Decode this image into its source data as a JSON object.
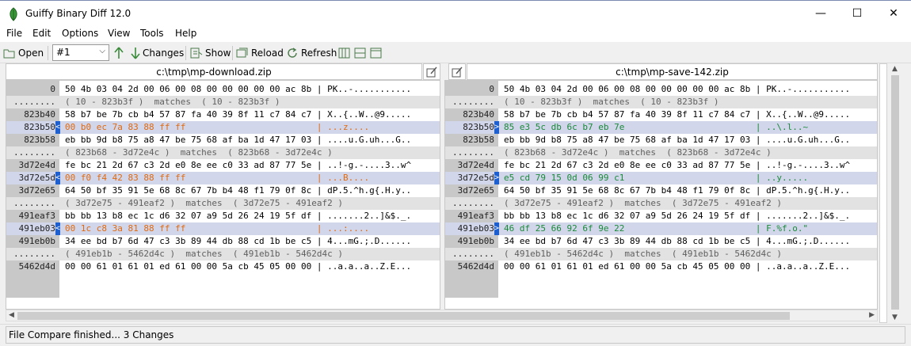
{
  "window": {
    "title": "Guiffy Binary Diff 12.0",
    "minimize": "—",
    "maximize": "☐",
    "close": "✕"
  },
  "menu": [
    "File",
    "Edit",
    "Options",
    "View",
    "Tools",
    "Help"
  ],
  "toolbar": {
    "open": "Open",
    "change_selector": "#1",
    "changes": "Changes",
    "show": "Show",
    "reload": "Reload",
    "refresh": "Refresh"
  },
  "left": {
    "file": "c:\\tmp\\mp-download.zip",
    "rows": [
      {
        "addr": "0",
        "marker": "",
        "kind": "normal",
        "hex": "50 4b 03 04 2d 00 06 00 08 00 00 00 00 00 ac 8b | PK..-..........."
      },
      {
        "addr": "........",
        "marker": "",
        "kind": "match",
        "hex": "( 10 - 823b3f )  matches  ( 10 - 823b3f )"
      },
      {
        "addr": "823b40",
        "marker": "",
        "kind": "normal",
        "hex": "58 b7 be 7b cb b4 57 87 fa 40 39 8f 11 c7 84 c7 | X..{..W..@9....."
      },
      {
        "addr": "823b50",
        "marker": "<",
        "kind": "chg-orange",
        "hex": "00 b0 ec 7a 83 88 ff ff                         | ...z...."
      },
      {
        "addr": "823b58",
        "marker": "",
        "kind": "normal",
        "hex": "eb bb 9d b8 75 a8 47 be 75 68 af ba 1d 47 17 03 | ....u.G.uh...G.."
      },
      {
        "addr": "........",
        "marker": "",
        "kind": "match",
        "hex": "( 823b68 - 3d72e4c )  matches  ( 823b68 - 3d72e4c )"
      },
      {
        "addr": "3d72e4d",
        "marker": "",
        "kind": "normal",
        "hex": "fe bc 21 2d 67 c3 2d e0 8e ee c0 33 ad 87 77 5e | ..!-g.-....3..w^"
      },
      {
        "addr": "3d72e5d",
        "marker": "<",
        "kind": "chg-orange",
        "hex": "00 f0 f4 42 83 88 ff ff                         | ...B...."
      },
      {
        "addr": "3d72e65",
        "marker": "",
        "kind": "normal",
        "hex": "64 50 bf 35 91 5e 68 8c 67 7b b4 48 f1 79 0f 8c | dP.5.^h.g{.H.y.."
      },
      {
        "addr": "........",
        "marker": "",
        "kind": "match",
        "hex": "( 3d72e75 - 491eaf2 )  matches  ( 3d72e75 - 491eaf2 )"
      },
      {
        "addr": "491eaf3",
        "marker": "",
        "kind": "normal",
        "hex": "bb bb 13 b8 ec 1c d6 32 07 a9 5d 26 24 19 5f df | .......2..]&$._."
      },
      {
        "addr": "491eb03",
        "marker": "<",
        "kind": "chg-orange",
        "hex": "00 1c c8 3a 81 88 ff ff                         | ...:...."
      },
      {
        "addr": "491eb0b",
        "marker": "",
        "kind": "normal",
        "hex": "34 ee bd b7 6d 47 c3 3b 89 44 db 88 cd 1b be c5 | 4...mG.;.D......"
      },
      {
        "addr": "........",
        "marker": "",
        "kind": "match",
        "hex": "( 491eb1b - 5462d4c )  matches  ( 491eb1b - 5462d4c )"
      },
      {
        "addr": "5462d4d",
        "marker": "",
        "kind": "normal",
        "hex": "00 00 61 01 61 01 ed 61 00 00 5a cb 45 05 00 00 | ..a.a..a..Z.E..."
      }
    ]
  },
  "right": {
    "file": "c:\\tmp\\mp-save-142.zip",
    "rows": [
      {
        "addr": "0",
        "marker": "",
        "kind": "normal",
        "hex": "50 4b 03 04 2d 00 06 00 08 00 00 00 00 00 ac 8b | PK..-..........."
      },
      {
        "addr": "........",
        "marker": "",
        "kind": "match",
        "hex": "( 10 - 823b3f )  matches  ( 10 - 823b3f )"
      },
      {
        "addr": "823b40",
        "marker": "",
        "kind": "normal",
        "hex": "58 b7 be 7b cb b4 57 87 fa 40 39 8f 11 c7 84 c7 | X..{..W..@9....."
      },
      {
        "addr": "823b50",
        "marker": ">",
        "kind": "chg-green",
        "hex": "85 e3 5c db 6c b7 eb 7e                         | ..\\.l..~"
      },
      {
        "addr": "823b58",
        "marker": "",
        "kind": "normal",
        "hex": "eb bb 9d b8 75 a8 47 be 75 68 af ba 1d 47 17 03 | ....u.G.uh...G.."
      },
      {
        "addr": "........",
        "marker": "",
        "kind": "match",
        "hex": "( 823b68 - 3d72e4c )  matches  ( 823b68 - 3d72e4c )"
      },
      {
        "addr": "3d72e4d",
        "marker": "",
        "kind": "normal",
        "hex": "fe bc 21 2d 67 c3 2d e0 8e ee c0 33 ad 87 77 5e | ..!-g.-....3..w^"
      },
      {
        "addr": "3d72e5d",
        "marker": ">",
        "kind": "chg-green",
        "hex": "e5 cd 79 15 0d 06 99 c1                         | ..y....."
      },
      {
        "addr": "3d72e65",
        "marker": "",
        "kind": "normal",
        "hex": "64 50 bf 35 91 5e 68 8c 67 7b b4 48 f1 79 0f 8c | dP.5.^h.g{.H.y.."
      },
      {
        "addr": "........",
        "marker": "",
        "kind": "match",
        "hex": "( 3d72e75 - 491eaf2 )  matches  ( 3d72e75 - 491eaf2 )"
      },
      {
        "addr": "491eaf3",
        "marker": "",
        "kind": "normal",
        "hex": "bb bb 13 b8 ec 1c d6 32 07 a9 5d 26 24 19 5f df | .......2..]&$._."
      },
      {
        "addr": "491eb03",
        "marker": ">",
        "kind": "chg-green",
        "hex": "46 df 25 66 92 6f 9e 22                         | F.%f.o.\""
      },
      {
        "addr": "491eb0b",
        "marker": "",
        "kind": "normal",
        "hex": "34 ee bd b7 6d 47 c3 3b 89 44 db 88 cd 1b be c5 | 4...mG.;.D......"
      },
      {
        "addr": "........",
        "marker": "",
        "kind": "match",
        "hex": "( 491eb1b - 5462d4c )  matches  ( 491eb1b - 5462d4c )"
      },
      {
        "addr": "5462d4d",
        "marker": "",
        "kind": "normal",
        "hex": "00 00 61 01 61 01 ed 61 00 00 5a cb 45 05 00 00 | ..a.a..a..Z.E..."
      }
    ]
  },
  "status": "File Compare finished...  3 Changes",
  "colors": {
    "changed_left": "#e06a10",
    "changed_right": "#1a8a3a",
    "changed_row_bg": "#d2d6ea",
    "match_row_bg": "#e2e2e2"
  }
}
